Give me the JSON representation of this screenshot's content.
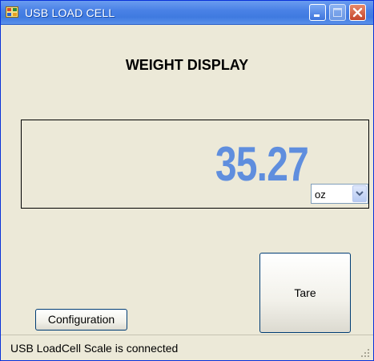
{
  "window": {
    "title": "USB LOAD CELL"
  },
  "heading": "WEIGHT DISPLAY",
  "reading": {
    "value": "35.27",
    "color": "#5f8ede"
  },
  "unit_select": {
    "selected": "oz"
  },
  "buttons": {
    "tare": "Tare",
    "configuration": "Configuration"
  },
  "status": {
    "text": "USB LoadCell Scale is connected"
  },
  "icons": [
    "app-icon",
    "minimize-icon",
    "maximize-icon",
    "close-icon",
    "chevron-down-icon",
    "resize-grip-icon"
  ]
}
